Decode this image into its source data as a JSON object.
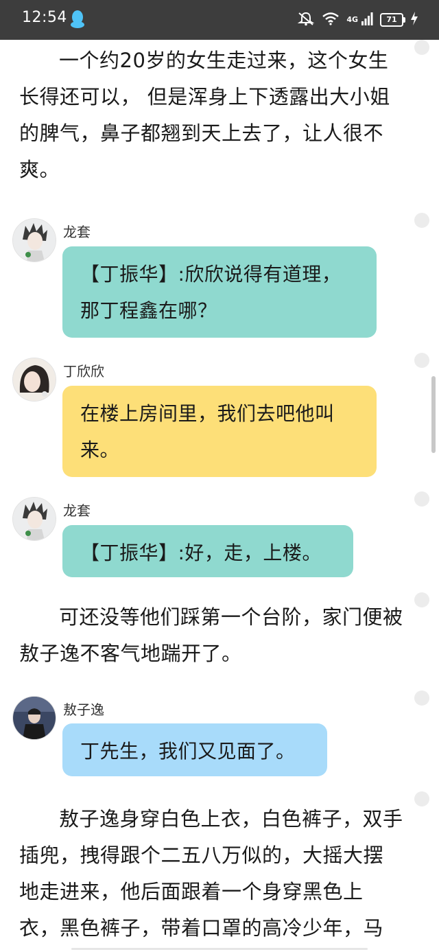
{
  "status_bar": {
    "time": "12:54",
    "network": "4G",
    "battery": "71",
    "icons": [
      "qq-icon",
      "mute-bell-icon",
      "wifi-icon",
      "signal-icon",
      "charging-icon"
    ]
  },
  "story": {
    "para1": "一个约20岁的女生走过来，这个女生长得还可以， 但是浑身上下透露出大小姐的脾气，鼻子都翘到天上去了，让人很不爽。",
    "para2": "可还没等他们踩第一个台阶，家门便被敖子逸不客气地踹开了。",
    "para3": "敖子逸身穿白色上衣，白色裤子，双手插兜，拽得跟个二五八万似的，大摇大摆地走进来，他后面跟着一个身穿黑色上衣，黑色裤子，带着口罩的高冷少年，马"
  },
  "messages": [
    {
      "speaker": "龙套",
      "text": "【丁振华】:欣欣说得有道理，那丁程鑫在哪？"
    },
    {
      "speaker": "丁欣欣",
      "text": "在楼上房间里，我们去吧他叫来。"
    },
    {
      "speaker": "龙套",
      "text": "【丁振华】:好，走，上楼。"
    },
    {
      "speaker": "敖子逸",
      "text": "丁先生，我们又见面了。"
    }
  ],
  "colors": {
    "status_bg": "#3d3d3d",
    "bubble_teal": "#8fd9cf",
    "bubble_yellow": "#fddf78",
    "bubble_blue": "#a8dbfa"
  }
}
